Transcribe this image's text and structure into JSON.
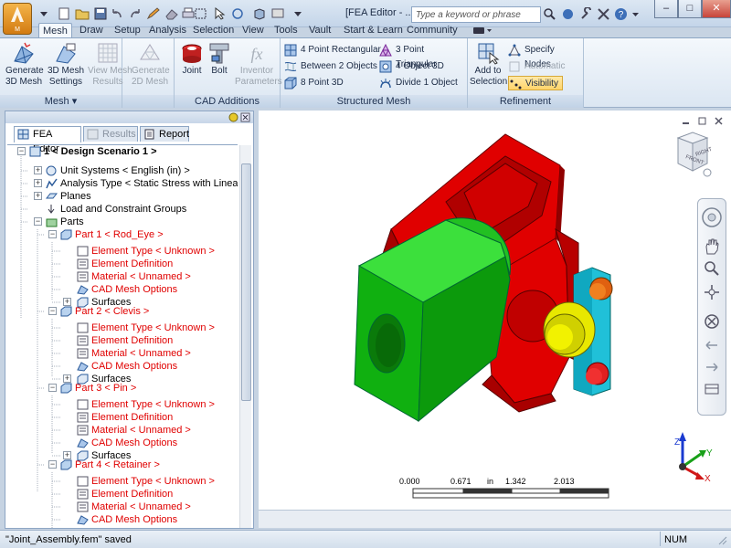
{
  "app": {
    "menu_button_label": "M",
    "window_title": "[FEA Editor - ..."
  },
  "search": {
    "placeholder": "Type a keyword or phrase"
  },
  "window_controls": {
    "minimize": "–",
    "maximize": "□",
    "close": "✕"
  },
  "ribbon_tabs": [
    "Mesh",
    "Draw",
    "Setup",
    "Analysis",
    "Selection",
    "View",
    "Tools",
    "Vault",
    "Start & Learn",
    "Community"
  ],
  "ribbon": {
    "mesh_group": {
      "label": "Mesh ▾",
      "generate_3d": "Generate\n3D Mesh",
      "mesh_settings": "3D Mesh\nSettings",
      "view_results": "View Mesh\nResults",
      "generate_2d": "Generate\n2D Mesh"
    },
    "cad_group": {
      "label": "CAD Additions",
      "joint": "Joint",
      "bolt": "Bolt",
      "inventor": "Inventor\nParameters"
    },
    "structured_group": {
      "label": "Structured Mesh",
      "rect4": "4 Point Rectangular",
      "between2": "Between 2 Objects",
      "pt8": "8 Point 3D",
      "tri3": "3 Point Triangular",
      "obj4": "4 Object 3D",
      "divide1": "Divide 1 Object"
    },
    "refinement_group": {
      "label": "Refinement",
      "add_selection": "Add to\nSelection",
      "specify_nodes": "Specify Nodes",
      "automatic": "Automatic",
      "visibility": "Visibility"
    }
  },
  "panel_tabs": {
    "fea_editor": "FEA Editor",
    "results": "Results",
    "report": "Report"
  },
  "tree": {
    "root": "1 < Design Scenario 1 >",
    "unit_systems": "Unit Systems < English (in) >",
    "analysis_type": "Analysis Type < Static Stress with Linear Materia",
    "planes": "Planes",
    "loads": "Load and Constraint Groups",
    "parts": "Parts",
    "part1": "Part 1 < Rod_Eye >",
    "part2": "Part 2 < Clevis >",
    "part3": "Part 3 < Pin >",
    "part4": "Part 4 < Retainer >",
    "element_type": "Element Type < Unknown >",
    "element_definition": "Element Definition",
    "material": "Material < Unnamed >",
    "cad_mesh_options": "CAD Mesh Options",
    "surfaces": "Surfaces"
  },
  "scale_bar": {
    "t0": "0.000",
    "t1": "0.671",
    "unit": "in",
    "t2": "1.342",
    "t3": "2.013"
  },
  "status": {
    "message": "\"Joint_Assembly.fem\" saved",
    "num": "NUM"
  },
  "colors": {
    "clevis": "#e00000",
    "rod_eye": "#10b010",
    "pin": "#e8e800",
    "retainer": "#20c0d8",
    "tree_red": "#e00000"
  }
}
